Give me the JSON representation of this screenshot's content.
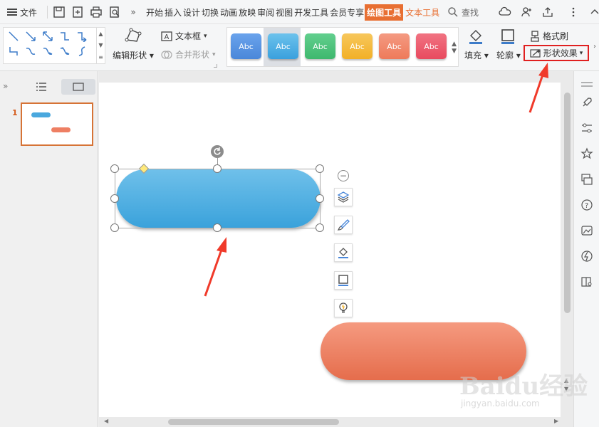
{
  "menubar": {
    "file_label": "文件",
    "tabs": [
      "开始",
      "插入",
      "设计",
      "切换",
      "动画",
      "放映",
      "审阅",
      "视图",
      "开发工具",
      "会员专享"
    ],
    "active_tab": "绘图工具",
    "text_tab": "文本工具",
    "search_label": "查找"
  },
  "ribbon": {
    "edit_shape_label": "编辑形状",
    "textbox_label": "文本框",
    "merge_shape_label": "合并形状",
    "style_swatches": [
      {
        "label": "Abc",
        "color": "#4a87d9"
      },
      {
        "label": "Abc",
        "color": "#3aa0dd"
      },
      {
        "label": "Abc",
        "color": "#3fb86e"
      },
      {
        "label": "Abc",
        "color": "#f2b027"
      },
      {
        "label": "Abc",
        "color": "#ee7a5a"
      },
      {
        "label": "Abc",
        "color": "#e84a5f"
      }
    ],
    "fill_label": "填充",
    "outline_label": "轮廓",
    "format_brush_label": "格式刷",
    "shape_effect_label": "形状效果"
  },
  "slide_panel": {
    "slide_number": "1"
  },
  "colors": {
    "accent": "#e86f32",
    "highlight_box": "#e02020",
    "annotation_arrow": "#f03a2a",
    "shape_blue": "#4aa8de",
    "shape_orange": "#ee7f63"
  },
  "watermark": {
    "logo_text": "Baidu经验",
    "url_text": "jingyan.baidu.com"
  }
}
